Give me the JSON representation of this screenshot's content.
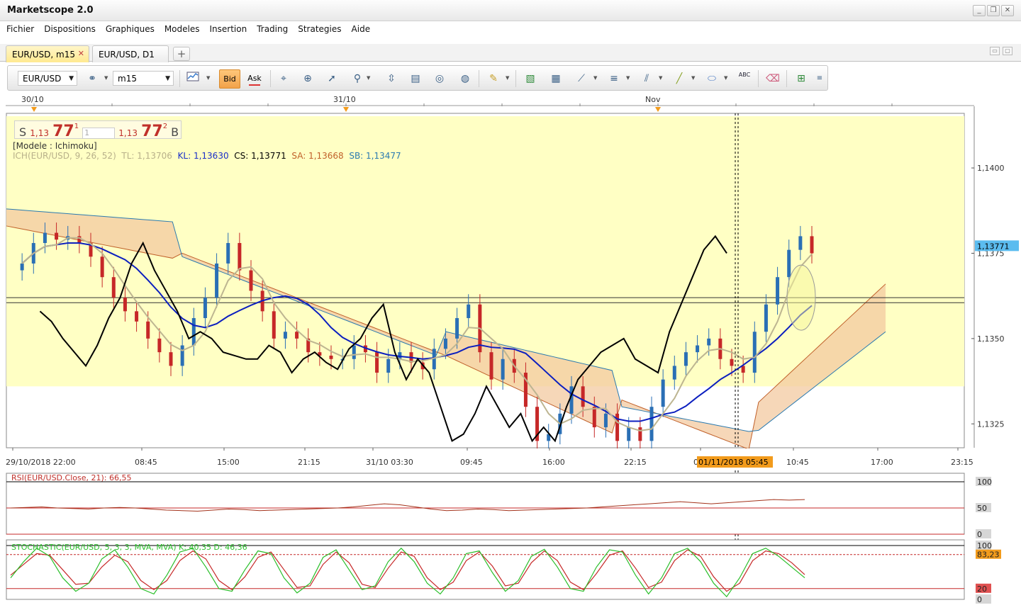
{
  "app": {
    "title": "Marketscope 2.0"
  },
  "window_controls": [
    "_",
    "❐",
    "✕"
  ],
  "menu": [
    "Fichier",
    "Dispositions",
    "Graphiques",
    "Modeles",
    "Insertion",
    "Trading",
    "Strategies",
    "Aide"
  ],
  "tabs": [
    {
      "label": "EUR/USD, m15",
      "active": true,
      "close": "✕"
    },
    {
      "label": "EUR/USD, D1",
      "active": false
    }
  ],
  "tab_add": "+",
  "toolbar": {
    "symbol": "EUR/USD",
    "timeframe": "m15",
    "bid_label": "Bid",
    "ask_label": "Ask",
    "abc_label": "ABC"
  },
  "quote": {
    "sell_prefix": "S",
    "sell_small": "1,13",
    "sell_big": "77",
    "sell_sup": "1",
    "amount": "1",
    "buy_small": "1,13",
    "buy_big": "77",
    "buy_sup": "2",
    "buy_suffix": "B"
  },
  "model_label": "[Modele : Ichimoku]",
  "ichimoku": {
    "name": "ICH(EUR/USD, 9, 26, 52)",
    "tl": "TL: 1,13706",
    "kl": "KL: 1,13630",
    "cs": "CS: 1,13771",
    "sa": "SA: 1,13668",
    "sb": "SB: 1,13477"
  },
  "rsi_label": "RSI(EUR/USD.Close, 21): 66,55",
  "stoch_label": "STOCHASTIC(EUR/USD, 5, 3, 3, MVA, MVA)  K: 40,35  D: 46,36",
  "chart_data": [
    {
      "type": "candlestick",
      "instrument": "EUR/USD",
      "period": "m15",
      "top_dates": [
        "30/10",
        "31/10",
        "Nov"
      ],
      "x_tick_labels": [
        "29/10/2018 22:00",
        "08:45",
        "15:00",
        "21:15",
        "31/10 03:30",
        "09:45",
        "16:00",
        "22:15",
        "0",
        "10:45",
        "17:00",
        "23:15"
      ],
      "crosshair_label": "01/11/2018 05:45",
      "y_tick_labels": [
        "1,1400",
        "1,1375",
        "1,1350",
        "1,1325"
      ],
      "ylim": [
        1.1318,
        1.1416
      ],
      "current_price": "1,13771",
      "current_price_value": 1.13771,
      "horizontal_lines": [
        1.1362,
        1.13605
      ],
      "series_colors": {
        "kijun": "#0c1fbf",
        "tenkan": "#bdb591",
        "chikou": "#000000",
        "senkou_a": "#c0602a",
        "senkou_b": "#2a7ab0",
        "bull": "#2a6fb5",
        "bear": "#c62828"
      },
      "price_path": [
        1.137,
        1.1372,
        1.1378,
        1.1381,
        1.1379,
        1.138,
        1.1378,
        1.1374,
        1.1368,
        1.1362,
        1.1358,
        1.1355,
        1.135,
        1.1346,
        1.1342,
        1.1348,
        1.1356,
        1.1362,
        1.1372,
        1.1378,
        1.137,
        1.1364,
        1.1358,
        1.135,
        1.1352,
        1.135,
        1.1346,
        1.1345,
        1.1344,
        1.1344,
        1.1348,
        1.1346,
        1.134,
        1.1344,
        1.1346,
        1.1343,
        1.1341,
        1.1347,
        1.135,
        1.1356,
        1.136,
        1.1346,
        1.1338,
        1.1344,
        1.134,
        1.133,
        1.132,
        1.1322,
        1.1328,
        1.1336,
        1.133,
        1.1324,
        1.1328,
        1.132,
        1.1324,
        1.132,
        1.133,
        1.1338,
        1.1342,
        1.1346,
        1.1348,
        1.135,
        1.1344,
        1.1342,
        1.134,
        1.1352,
        1.136,
        1.1368,
        1.1376,
        1.138,
        1.1375
      ]
    },
    {
      "type": "line",
      "name": "RSI",
      "y_tick_labels": [
        "100",
        "50",
        "0"
      ],
      "ylim": [
        0,
        100
      ],
      "levels": [
        30,
        70
      ],
      "values": [
        50,
        51,
        52,
        50,
        49,
        48,
        50,
        51,
        50,
        48,
        46,
        45,
        44,
        46,
        48,
        47,
        45,
        46,
        47,
        48,
        49,
        50,
        52,
        55,
        58,
        56,
        52,
        48,
        45,
        46,
        48,
        47,
        45,
        46,
        47,
        48,
        49,
        50,
        52,
        54,
        56,
        58,
        60,
        62,
        60,
        58,
        60,
        62,
        64,
        66,
        65,
        66
      ]
    },
    {
      "type": "line",
      "name": "STOCHASTIC",
      "y_tick_labels": [
        "100",
        "83,23",
        "20",
        "0"
      ],
      "ylim": [
        0,
        100
      ],
      "levels": [
        20,
        80
      ],
      "k_values": [
        40,
        70,
        95,
        80,
        40,
        15,
        30,
        75,
        92,
        60,
        20,
        10,
        45,
        88,
        95,
        60,
        20,
        15,
        55,
        90,
        85,
        40,
        12,
        30,
        78,
        92,
        55,
        18,
        25,
        70,
        95,
        70,
        30,
        10,
        40,
        85,
        90,
        50,
        15,
        35,
        80,
        93,
        60,
        20,
        15,
        60,
        92,
        88,
        45,
        10,
        40,
        85,
        95,
        70,
        30,
        5,
        40,
        85,
        95,
        80,
        60,
        40
      ],
      "d_values": [
        45,
        65,
        85,
        82,
        55,
        28,
        30,
        60,
        82,
        70,
        35,
        18,
        35,
        72,
        90,
        75,
        35,
        18,
        42,
        78,
        88,
        55,
        22,
        25,
        65,
        88,
        68,
        28,
        22,
        58,
        88,
        80,
        40,
        18,
        32,
        72,
        88,
        62,
        25,
        30,
        68,
        90,
        72,
        32,
        18,
        48,
        82,
        90,
        58,
        22,
        32,
        72,
        92,
        80,
        42,
        15,
        30,
        72,
        90,
        85,
        68,
        46
      ]
    }
  ]
}
